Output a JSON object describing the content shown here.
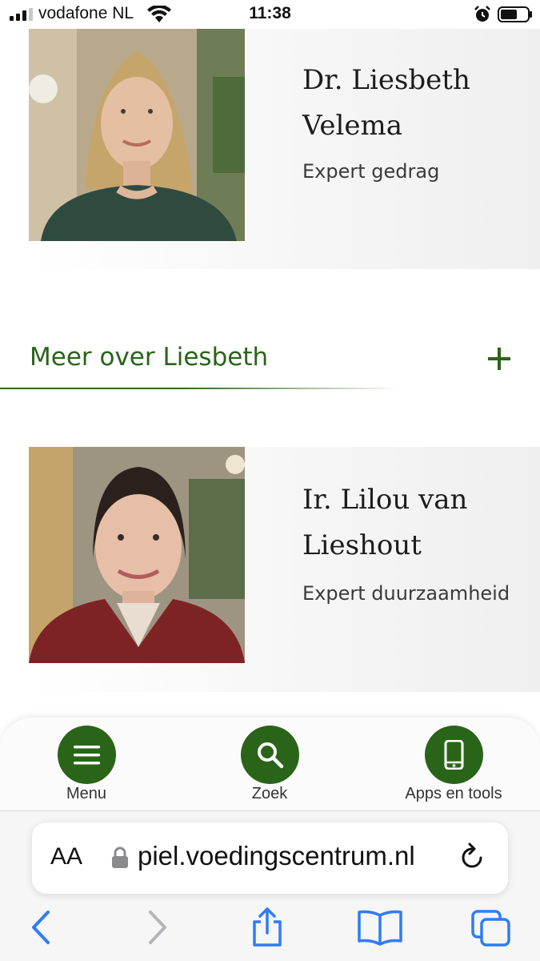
{
  "status_bar": {
    "carrier": "vodafone NL",
    "time": "11:38"
  },
  "experts": [
    {
      "name": "Dr. Liesbeth Velema",
      "role": "Expert gedrag"
    },
    {
      "name": "Ir. Lilou van Lieshout",
      "role": "Expert duurzaamheid"
    }
  ],
  "accordion": {
    "label": "Meer over Liesbeth"
  },
  "bottom_nav": {
    "menu_label": "Menu",
    "search_label": "Zoek",
    "apps_label": "Apps en tools"
  },
  "browser": {
    "text_size_label": "AA",
    "url": "piel.voedingscentrum.nl"
  },
  "colors": {
    "brand_green": "#2a6419",
    "ios_blue": "#2f7cf6"
  }
}
